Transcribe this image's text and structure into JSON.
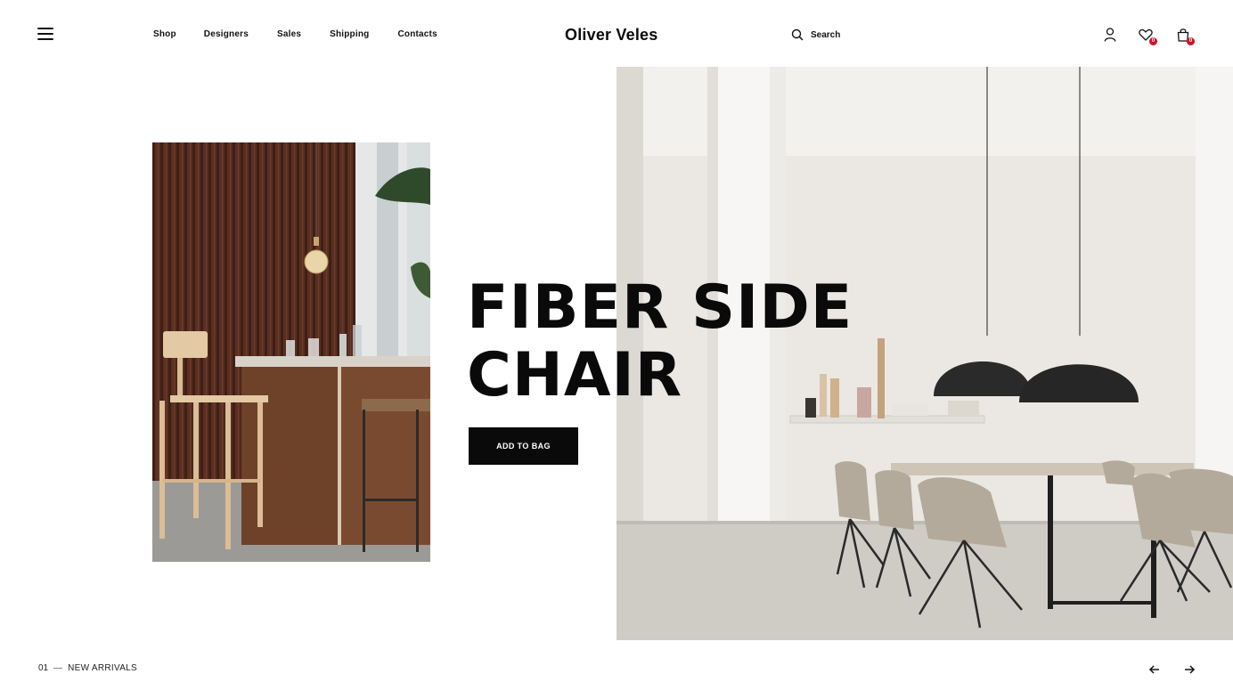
{
  "header": {
    "brand": "Oliver Veles",
    "nav": [
      "Shop",
      "Designers",
      "Sales",
      "Shipping",
      "Contacts"
    ],
    "search_label": "Search",
    "wishlist_count": "0",
    "cart_count": "0"
  },
  "hero": {
    "title_line1": "FIBER SIDE",
    "title_line2": "CHAIR",
    "cta_label": "ADD TO BAG"
  },
  "slider": {
    "index": "01",
    "section_label": "NEW ARRIVALS"
  },
  "colors": {
    "accent": "#0a0a0a",
    "badge": "#d0112b",
    "background": "#ffffff"
  },
  "icons": [
    "hamburger-menu-icon",
    "search-icon",
    "user-icon",
    "heart-icon",
    "shopping-bag-icon",
    "arrow-left-icon",
    "arrow-right-icon"
  ]
}
